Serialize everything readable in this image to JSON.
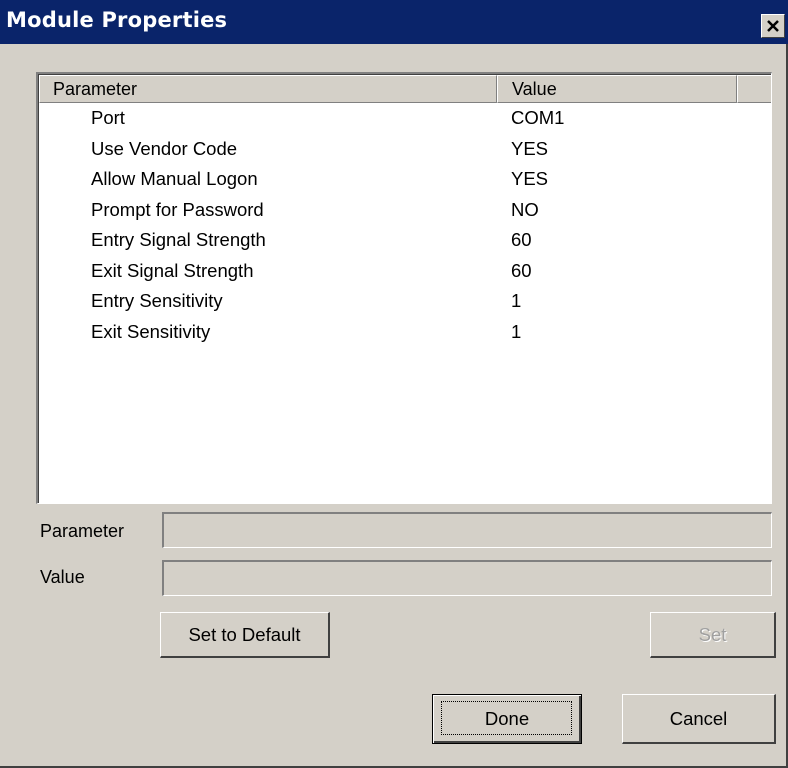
{
  "window": {
    "title": "Module Properties",
    "close_label": "close"
  },
  "list": {
    "columns": [
      "Parameter",
      "Value"
    ],
    "rows": [
      {
        "parameter": "Port",
        "value": "COM1"
      },
      {
        "parameter": "Use Vendor Code",
        "value": "YES"
      },
      {
        "parameter": "Allow Manual Logon",
        "value": "YES"
      },
      {
        "parameter": "Prompt for Password",
        "value": "NO"
      },
      {
        "parameter": "Entry Signal Strength",
        "value": "60"
      },
      {
        "parameter": "Exit Signal Strength",
        "value": "60"
      },
      {
        "parameter": "Entry Sensitivity",
        "value": "1"
      },
      {
        "parameter": "Exit Sensitivity",
        "value": "1"
      }
    ]
  },
  "edit": {
    "parameter_label": "Parameter",
    "parameter_value": "",
    "value_label": "Value",
    "value_value": ""
  },
  "buttons": {
    "set_default": "Set to Default",
    "set": "Set",
    "done": "Done",
    "cancel": "Cancel"
  },
  "colors": {
    "titlebar": "#0a246a",
    "face": "#d4d0c8"
  }
}
